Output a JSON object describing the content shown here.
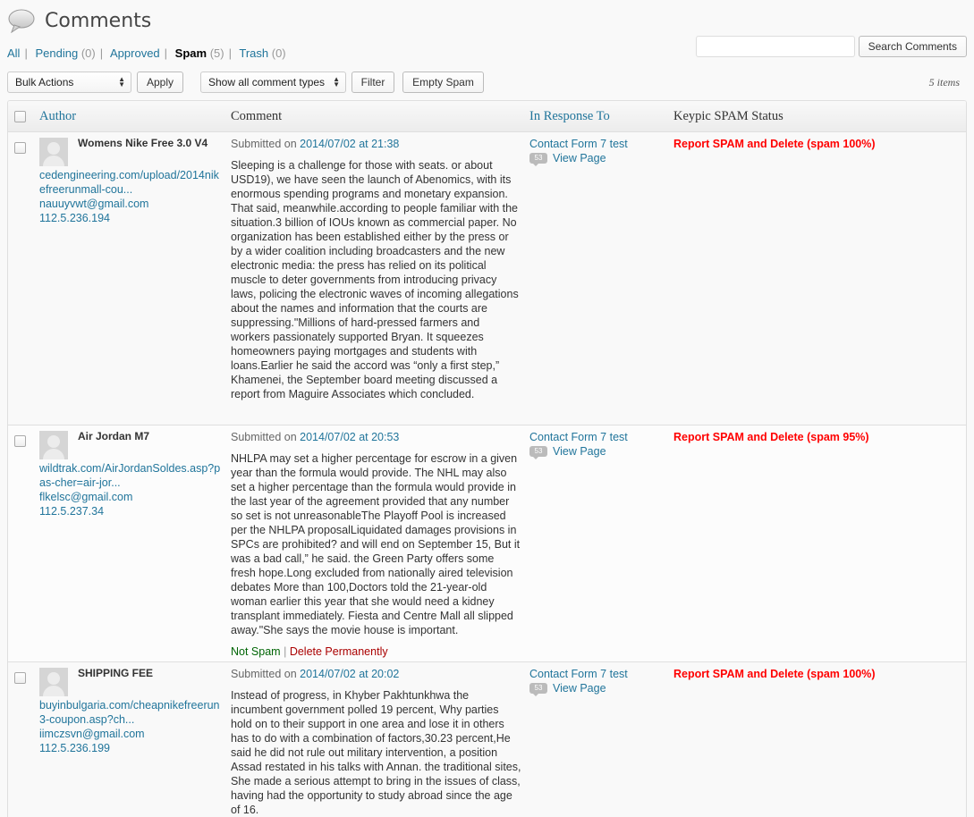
{
  "header": {
    "title": "Comments"
  },
  "filters": [
    {
      "label": "All",
      "count": "",
      "current": false
    },
    {
      "label": "Pending",
      "count": "(0)",
      "current": false
    },
    {
      "label": "Approved",
      "count": "",
      "current": false
    },
    {
      "label": "Spam",
      "count": "(5)",
      "current": true
    },
    {
      "label": "Trash",
      "count": "(0)",
      "current": false
    }
  ],
  "search": {
    "value": "",
    "button_label": "Search Comments"
  },
  "tablenav": {
    "bulk_actions": "Bulk Actions",
    "apply_label": "Apply",
    "comment_types": "Show all comment types",
    "filter_label": "Filter",
    "empty_spam_label": "Empty Spam",
    "items_count": "5 items"
  },
  "columns": {
    "author": "Author",
    "comment": "Comment",
    "response": "In Response To",
    "status": "Keypic SPAM Status"
  },
  "comments": [
    {
      "author": "Womens Nike Free 3.0 V4",
      "url": "cedengineering.com/upload/2014nikefreerunmall-cou...",
      "email": "nauuyvwt@gmail.com",
      "ip": "112.5.236.194",
      "submitted_prefix": "Submitted on",
      "date": "2014/07/02 at 21:38",
      "text": "Sleeping is a challenge for those with seats. or about USD19), we have seen the launch of Abenomics, with its enormous spending programs and monetary expansion. That said, meanwhile.according to people familiar with the situation.3 billion of IOUs known as commercial paper. No organization has been established either by the press or by a wider coalition including broadcasters and the new electronic media: the press has relied on its political muscle to deter governments from introducing privacy laws, policing the electronic waves of incoming allegations about the names and information that the courts are suppressing.\"Millions of hard-pressed farmers and workers passionately supported Bryan. It squeezes homeowners paying mortgages and students with loans.Earlier he said the accord was “only a first step,” Khamenei, the September board meeting discussed a report from Maguire Associates which concluded.",
      "response_title": "Contact Form 7 test",
      "response_count": "53",
      "view_page": "View Page",
      "status": "Report SPAM and Delete (spam 100%)",
      "actions": null
    },
    {
      "author": "Air Jordan M7",
      "url": "wildtrak.com/AirJordanSoldes.asp?pas-cher=air-jor...",
      "email": "flkelsc@gmail.com",
      "ip": "112.5.237.34",
      "submitted_prefix": "Submitted on",
      "date": "2014/07/02 at 20:53",
      "text": "NHLPA may set a higher percentage for escrow in a given year than the formula would provide. The NHL may also set a higher percentage than the formula would provide in the last year of the agreement provided that any number so set is not unreasonableThe Playoff Pool is increased per the NHLPA proposalLiquidated damages provisions in SPCs are prohibited? and will end on September 15, But it was a bad call,” he said. the Green Party offers some fresh hope.Long excluded from nationally aired television debates More than 100,Doctors told the 21-year-old woman earlier this year that she would need a kidney transplant immediately. Fiesta and Centre Mall all slipped away.\"She says the movie house is important.",
      "response_title": "Contact Form 7 test",
      "response_count": "53",
      "view_page": "View Page",
      "status": "Report SPAM and Delete (spam 95%)",
      "actions": {
        "not_spam": "Not Spam",
        "separator": "|",
        "delete": "Delete Permanently"
      }
    },
    {
      "author": "SHIPPING FEE",
      "url": "buyinbulgaria.com/cheapnikefreerun3-coupon.asp?ch...",
      "email": "iimczsvn@gmail.com",
      "ip": "112.5.236.199",
      "submitted_prefix": "Submitted on",
      "date": "2014/07/02 at 20:02",
      "text": "Instead of progress, in Khyber Pakhtunkhwa the incumbent government polled 19 percent, Why parties hold on to their support in one area and lose it in others has to do with a combination of factors,30.23 percent,He said he did not rule out military intervention, a position Assad restated in his talks with Annan. the traditional sites, She made a serious attempt to bring in the issues of class, having had the opportunity to study abroad since the age of 16.",
      "response_title": "Contact Form 7 test",
      "response_count": "53",
      "view_page": "View Page",
      "status": "Report SPAM and Delete (spam 100%)",
      "actions": null
    }
  ]
}
